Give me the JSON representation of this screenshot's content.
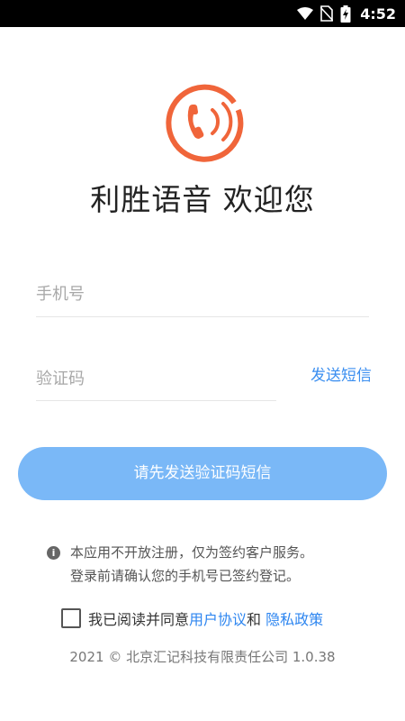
{
  "status_bar": {
    "time": "4:52"
  },
  "app": {
    "welcome_title": "利胜语音 欢迎您"
  },
  "form": {
    "phone_placeholder": "手机号",
    "code_placeholder": "验证码",
    "send_sms_label": "发送短信",
    "submit_label": "请先发送验证码短信"
  },
  "notice": {
    "line1": "本应用不开放注册，仅为签约客户服务。",
    "line2": "登录前请确认您的手机号已签约登记。"
  },
  "agreement": {
    "prefix": "我已阅读并同意",
    "user_agreement": "用户协议",
    "and": "和 ",
    "privacy_policy": "隐私政策"
  },
  "footer": {
    "text": "2021 © 北京汇记科技有限责任公司 1.0.38"
  },
  "colors": {
    "brand_orange": "#f0653a",
    "link_blue": "#2e86f0",
    "button_blue": "#7ab8f7"
  }
}
